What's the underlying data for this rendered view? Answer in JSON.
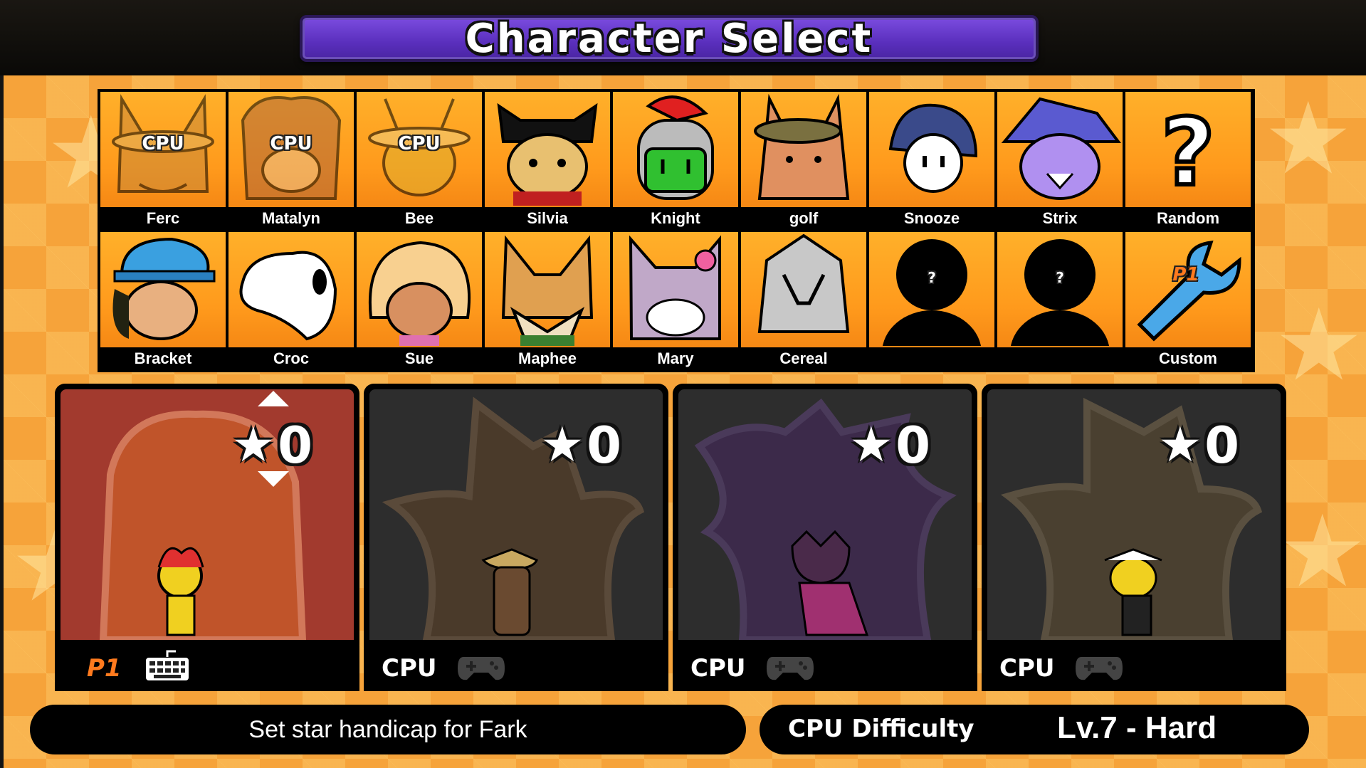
{
  "screen": {
    "title": "Character Select"
  },
  "roster": [
    {
      "name": "Ferc",
      "cpu_tag": "CPU",
      "taken": true,
      "color": "#c98a3a"
    },
    {
      "name": "Matalyn",
      "cpu_tag": "CPU",
      "taken": true,
      "color": "#b0683a"
    },
    {
      "name": "Bee",
      "cpu_tag": "CPU",
      "taken": true,
      "color": "#e0b030"
    },
    {
      "name": "Silvia",
      "cpu_tag": "",
      "taken": false,
      "color": "#e8c070"
    },
    {
      "name": "Knight",
      "cpu_tag": "",
      "taken": false,
      "color": "#3cc03c"
    },
    {
      "name": "golf",
      "cpu_tag": "",
      "taken": false,
      "color": "#e09060"
    },
    {
      "name": "Snooze",
      "cpu_tag": "",
      "taken": false,
      "color": "#3a4a8a"
    },
    {
      "name": "Strix",
      "cpu_tag": "",
      "taken": false,
      "color": "#9a70e0"
    },
    {
      "name": "Random",
      "cpu_tag": "",
      "taken": false,
      "color": "#ffffff"
    },
    {
      "name": "Bracket",
      "cpu_tag": "",
      "taken": false,
      "color": "#3aa0e0"
    },
    {
      "name": "Croc",
      "cpu_tag": "",
      "taken": false,
      "color": "#ffffff"
    },
    {
      "name": "Sue",
      "cpu_tag": "",
      "taken": false,
      "color": "#f0c080"
    },
    {
      "name": "Maphee",
      "cpu_tag": "",
      "taken": false,
      "color": "#e0a050"
    },
    {
      "name": "Mary",
      "cpu_tag": "",
      "taken": false,
      "color": "#d0b0d0"
    },
    {
      "name": "Cereal",
      "cpu_tag": "",
      "taken": false,
      "color": "#c0c0c0"
    },
    {
      "name": "",
      "cpu_tag": "",
      "taken": false,
      "locked_mark": "?",
      "color": "#000000"
    },
    {
      "name": "",
      "cpu_tag": "",
      "taken": false,
      "locked_mark": "?",
      "color": "#000000"
    },
    {
      "name": "Custom",
      "cpu_tag": "",
      "taken": false,
      "custom_tag": "P1",
      "color": "#3aa0e0"
    }
  ],
  "players": [
    {
      "label": "P1",
      "stars": "0",
      "input": "keyboard-icon",
      "bg": "#a23a2e",
      "fighter_color": "#f0d020"
    },
    {
      "label": "CPU",
      "stars": "0",
      "input": "gamepad-icon",
      "bg": "#2d2d2d",
      "fighter_color": "#6a4a30"
    },
    {
      "label": "CPU",
      "stars": "0",
      "input": "gamepad-icon",
      "bg": "#2d2d2d",
      "fighter_color": "#4a2a5a"
    },
    {
      "label": "CPU",
      "stars": "0",
      "input": "gamepad-icon",
      "bg": "#2d2d2d",
      "fighter_color": "#f0d020"
    }
  ],
  "hint": {
    "text": "Set star handicap for Fark"
  },
  "difficulty": {
    "label": "CPU Difficulty",
    "value": "Lv.7 - Hard"
  },
  "colors": {
    "title_purple": "#5a2fbd",
    "orange_bg": "#f6a33a",
    "p1_orange": "#ff7a1e"
  }
}
